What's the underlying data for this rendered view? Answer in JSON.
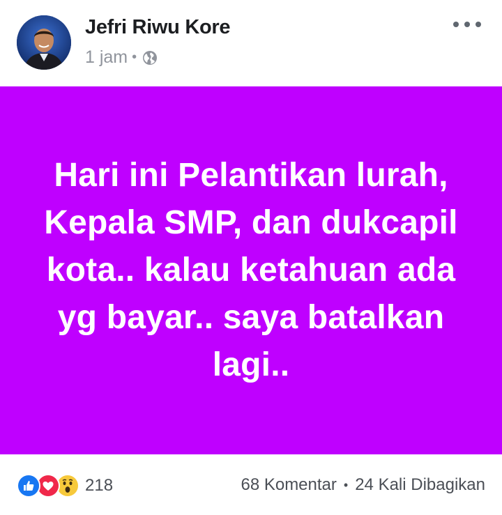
{
  "post": {
    "author": {
      "name": "Jefri Riwu Kore"
    },
    "timestamp": "1 jam",
    "separator": "•",
    "privacy_icon": "globe-icon",
    "more_icon": "more-dots-icon",
    "status": {
      "background_color": "#bf00ff",
      "text": "Hari ini Pelantikan lurah, Kepala SMP, dan dukcapil kota.. kalau ketahuan ada yg bayar.. saya batalkan lagi.."
    },
    "reactions": {
      "icons": [
        "like-reaction-icon",
        "love-reaction-icon",
        "wow-reaction-icon"
      ],
      "count": "218"
    },
    "comments": "68 Komentar",
    "shares": "24 Kali Dibagikan",
    "engagement_separator": "•"
  },
  "colors": {
    "like": "#1877f2",
    "love": "#f0284a",
    "wow": "#f7c93b",
    "meta_text": "#90949c"
  }
}
